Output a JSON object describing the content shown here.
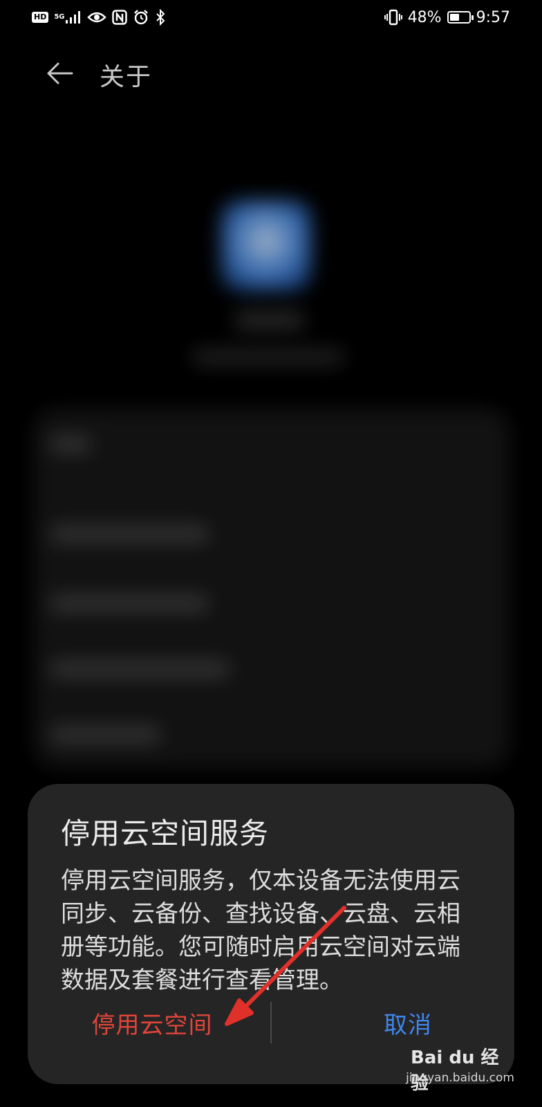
{
  "status_bar": {
    "hd_label": "HD",
    "network_label": "5G",
    "battery_percent_text": "48%",
    "battery_level": 0.48,
    "time": "9:57"
  },
  "header": {
    "title": "关于"
  },
  "dialog": {
    "title": "停用云空间服务",
    "message": "停用云空间服务，仅本设备无法使用云同步、云备份、查找设备、云盘、云相册等功能。您可随时启用云空间对云端数据及套餐进行查看管理。",
    "confirm_label": "停用云空间",
    "cancel_label": "取消"
  },
  "colors": {
    "confirm": "#e0453a",
    "cancel": "#3f86ec",
    "dialog_bg": "#252525",
    "annotation_arrow": "#e0302a"
  },
  "watermark": {
    "logo_text": "Bai du 经验",
    "url": "jingyan.baidu.com"
  },
  "icons": {
    "back": "back-arrow-icon",
    "signal": "signal-icon",
    "eye": "eye-comfort-icon",
    "nfc": "nfc-icon",
    "alarm": "alarm-icon",
    "bluetooth": "bluetooth-icon",
    "vibrate": "vibrate-icon",
    "battery": "battery-icon"
  }
}
